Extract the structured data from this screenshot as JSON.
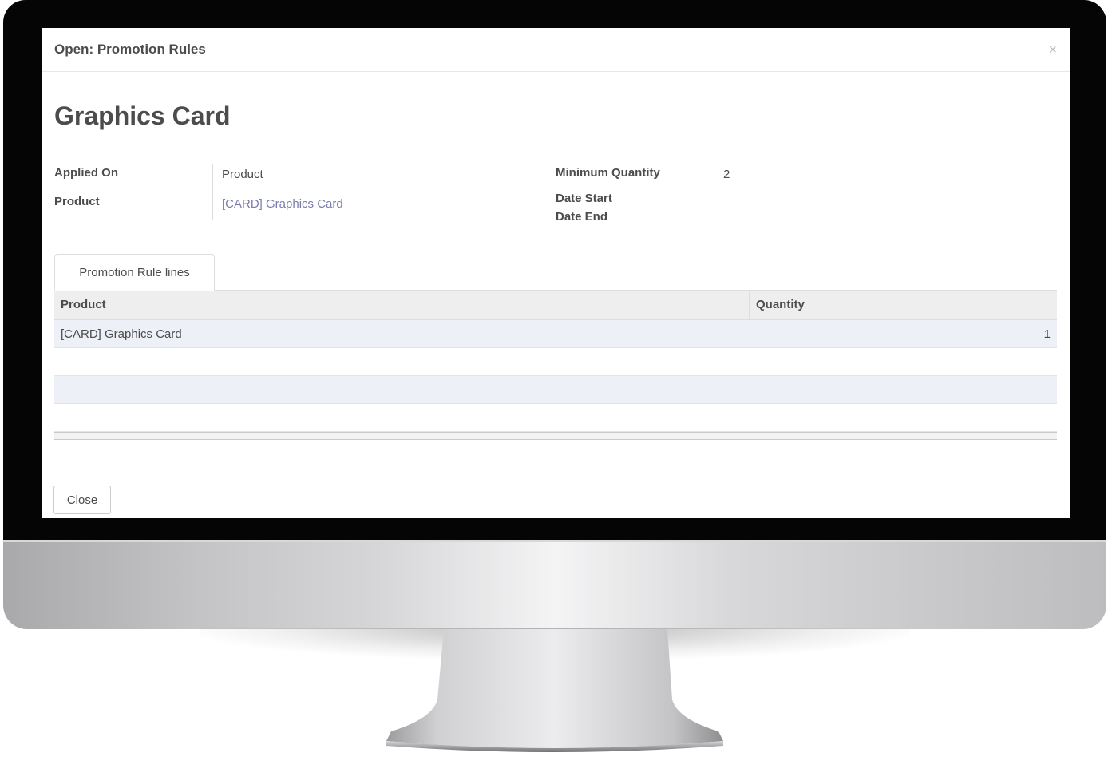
{
  "dialog": {
    "title": "Open: Promotion Rules",
    "close_icon": "×"
  },
  "record": {
    "name": "Graphics Card"
  },
  "fields": {
    "applied_on_label": "Applied On",
    "applied_on_value": "Product",
    "product_label": "Product",
    "product_value": "[CARD] Graphics Card",
    "min_qty_label": "Minimum Quantity",
    "min_qty_value": "2",
    "date_start_label": "Date Start",
    "date_end_label": "Date End"
  },
  "tabs": [
    {
      "label": "Promotion Rule lines",
      "active": true
    }
  ],
  "table": {
    "columns": [
      "Product",
      "Quantity"
    ],
    "rows": [
      {
        "product": "[CARD] Graphics Card",
        "quantity": "1"
      }
    ]
  },
  "footer": {
    "close_label": "Close"
  },
  "colors": {
    "link": "#7c7bad",
    "row_stripe": "#eef0f8",
    "bezel": "#050505"
  }
}
